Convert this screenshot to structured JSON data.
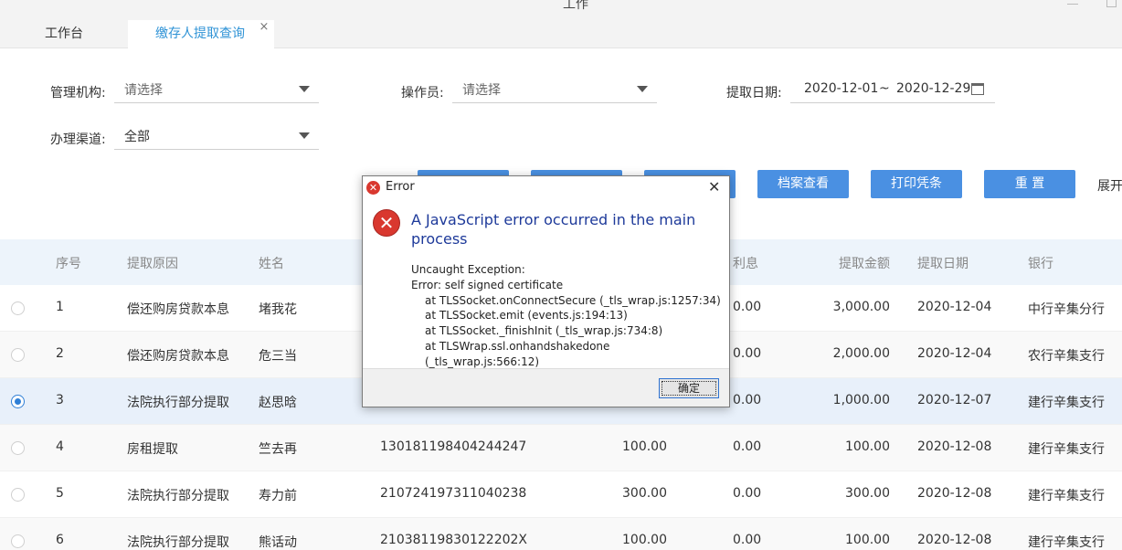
{
  "window": {
    "title": "工作"
  },
  "tabs": [
    {
      "label": "工作台"
    },
    {
      "label": "缴存人提取查询",
      "close": "×"
    }
  ],
  "filters": {
    "org_label": "管理机构:",
    "org_placeholder": "请选择",
    "operator_label": "操作员:",
    "operator_placeholder": "请选择",
    "date_label": "提取日期:",
    "date_start": "2020-12-01",
    "date_sep": "~",
    "date_end": "2020-12-29",
    "channel_label": "办理渠道:",
    "channel_value": "全部"
  },
  "toolbar": {
    "archive": "档案查看",
    "print": "打印凭条",
    "reset": "重 置",
    "expand": "展开"
  },
  "table": {
    "columns": [
      "序号",
      "提取原因",
      "姓名",
      "利息",
      "提取金额",
      "提取日期",
      "银行"
    ],
    "rows": [
      {
        "no": "1",
        "reason": "偿还购房贷款本息",
        "name": "堵我花",
        "id": "",
        "amount1": "",
        "interest": "0.00",
        "amount": "3,000.00",
        "date": "2020-12-04",
        "bank": "中行辛集分行"
      },
      {
        "no": "2",
        "reason": "偿还购房贷款本息",
        "name": "危三当",
        "id": "",
        "amount1": "",
        "interest": "0.00",
        "amount": "2,000.00",
        "date": "2020-12-04",
        "bank": "农行辛集支行"
      },
      {
        "no": "3",
        "reason": "法院执行部分提取",
        "name": "赵思晗",
        "id": "",
        "amount1": "",
        "interest": "0.00",
        "amount": "1,000.00",
        "date": "2020-12-07",
        "bank": "建行辛集支行"
      },
      {
        "no": "4",
        "reason": "房租提取",
        "name": "竺去再",
        "id": "130181198404244247",
        "amount1": "100.00",
        "interest": "0.00",
        "amount": "100.00",
        "date": "2020-12-08",
        "bank": "建行辛集支行"
      },
      {
        "no": "5",
        "reason": "法院执行部分提取",
        "name": "寿力前",
        "id": "210724197311040238",
        "amount1": "300.00",
        "interest": "0.00",
        "amount": "300.00",
        "date": "2020-12-08",
        "bank": "建行辛集支行"
      },
      {
        "no": "6",
        "reason": "法院执行部分提取",
        "name": "熊话动",
        "id": "21038119830122202X",
        "amount1": "100.00",
        "interest": "0.00",
        "amount": "100.00",
        "date": "2020-12-08",
        "bank": "建行辛集支行"
      }
    ],
    "selected_row": 3
  },
  "dialog": {
    "title": "Error",
    "message": "A JavaScript error occurred in the main process",
    "detail": [
      "Uncaught Exception:",
      "Error: self signed certificate",
      "at TLSSocket.onConnectSecure (_tls_wrap.js:1257:34)",
      "at TLSSocket.emit (events.js:194:13)",
      "at TLSSocket._finishInit (_tls_wrap.js:734:8)",
      "at TLSWrap.ssl.onhandshakedone (_tls_wrap.js:566:12)"
    ],
    "ok_label": "确定",
    "close": "✕",
    "error_glyph": "✕"
  },
  "colors": {
    "accent": "#4a90e2",
    "tab_active": "#2f93d6",
    "error": "#d9382f",
    "dialog_text": "#1e3a9a"
  },
  "icons": [
    "close-icon",
    "caret-down-icon",
    "calendar-icon",
    "error-icon",
    "radio-icon",
    "minimize-icon",
    "restore-icon"
  ]
}
